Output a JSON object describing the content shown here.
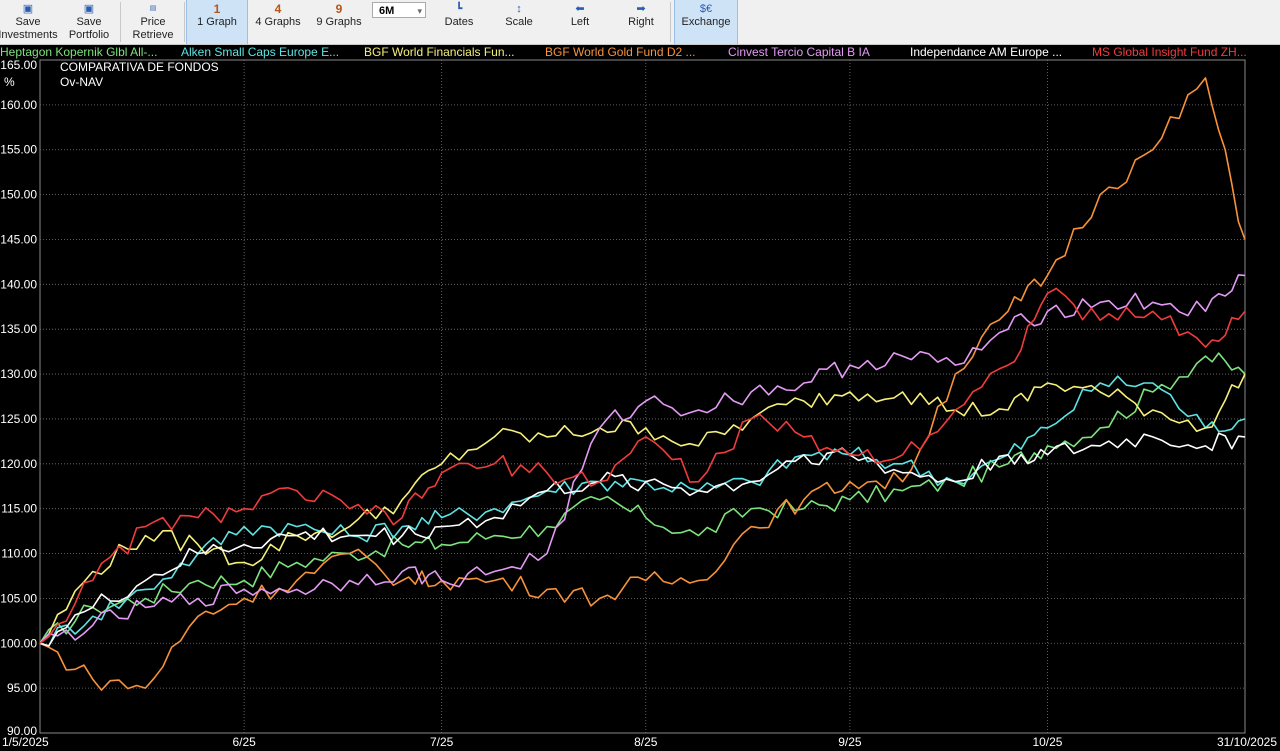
{
  "toolbar": {
    "save_investments": [
      "Save",
      "Investments"
    ],
    "save_portfolio": [
      "Save",
      "Portfolio"
    ],
    "price_retrieve": [
      "Price",
      "Retrieve"
    ],
    "graphs": [
      {
        "num": "1",
        "label": "1 Graph",
        "selected": true
      },
      {
        "num": "4",
        "label": "4 Graphs",
        "selected": false
      },
      {
        "num": "9",
        "label": "9 Graphs",
        "selected": false
      }
    ],
    "period": "6M",
    "dates": "Dates",
    "scale": "Scale",
    "left": "Left",
    "right": "Right",
    "exchange": "Exchange"
  },
  "chart_data": {
    "type": "line",
    "title": "COMPARATIVA DE FONDOS",
    "subtitle": "Ov-NAV",
    "ylabel": "%",
    "ylim": [
      90,
      165
    ],
    "yticks": [
      "165.00",
      "160.00",
      "155.00",
      "150.00",
      "145.00",
      "140.00",
      "135.00",
      "130.00",
      "125.00",
      "120.00",
      "115.00",
      "110.00",
      "105.00",
      "100.00",
      "95.00",
      "90.00"
    ],
    "xticks": [
      "1/5/2025",
      "6/25",
      "7/25",
      "8/25",
      "9/25",
      "10/25",
      "31/10/2025"
    ],
    "grid": true,
    "legend_position": "top",
    "x": [
      "2025-05-01",
      "2025-05-09",
      "2025-05-17",
      "2025-05-25",
      "2025-06-01",
      "2025-06-09",
      "2025-06-17",
      "2025-06-25",
      "2025-07-01",
      "2025-07-09",
      "2025-07-17",
      "2025-07-25",
      "2025-08-01",
      "2025-08-09",
      "2025-08-17",
      "2025-08-25",
      "2025-09-01",
      "2025-09-09",
      "2025-09-17",
      "2025-09-25",
      "2025-10-01",
      "2025-10-09",
      "2025-10-17",
      "2025-10-25",
      "2025-10-31"
    ],
    "series": [
      {
        "name": "Heptagon Kopernik Glbl All-...",
        "color": "#7de37d",
        "values": [
          100,
          104,
          105,
          107,
          107,
          109,
          110,
          111,
          111,
          112,
          113,
          116,
          114,
          112,
          115,
          115,
          116,
          117,
          118,
          120,
          122,
          124,
          128,
          132,
          130
        ]
      },
      {
        "name": "Alken Small Caps Europe E...",
        "color": "#5de3e3",
        "values": [
          100,
          103,
          106,
          110,
          113,
          113,
          112,
          113,
          114,
          115,
          117,
          118,
          118,
          117,
          118,
          121,
          121,
          120,
          118,
          121,
          124,
          129,
          129,
          124,
          125
        ]
      },
      {
        "name": "BGF World Financials Fun...",
        "color": "#f5f07a",
        "values": [
          100,
          108,
          112,
          111,
          109,
          112,
          113,
          116,
          120,
          123,
          123,
          124,
          124,
          122,
          125,
          127,
          128,
          128,
          126,
          126,
          129,
          128,
          126,
          124,
          130
        ]
      },
      {
        "name": "BGF World Gold Fund D2 ...",
        "color": "#f7923a",
        "values": [
          100,
          96,
          95,
          103,
          105,
          107,
          110,
          107,
          107,
          107,
          106,
          105,
          107,
          107,
          113,
          116,
          118,
          118,
          130,
          137,
          141,
          150,
          155,
          163,
          145
        ]
      },
      {
        "name": "Cinvest Tercio Capital B IA",
        "color": "#e49af5",
        "values": [
          100,
          102,
          104,
          105,
          106,
          106,
          107,
          108,
          107,
          108,
          110,
          124,
          127,
          126,
          128,
          129,
          131,
          132,
          131,
          135,
          137,
          138,
          138,
          137,
          141
        ]
      },
      {
        "name": "Independance AM Europe ...",
        "color": "#ffffff",
        "values": [
          100,
          104,
          107,
          110,
          111,
          112,
          112,
          112,
          113,
          114,
          117,
          118,
          118,
          117,
          118,
          121,
          121,
          119,
          118,
          121,
          121,
          122,
          123,
          122,
          123
        ]
      },
      {
        "name": "MS Global Insight Fund ZH...",
        "color": "#f03c3c",
        "values": [
          100,
          107,
          113,
          114,
          115,
          117,
          115,
          114,
          119,
          120,
          119,
          118,
          123,
          118,
          125,
          123,
          121,
          121,
          126,
          131,
          139,
          136,
          137,
          133,
          137
        ]
      }
    ]
  }
}
